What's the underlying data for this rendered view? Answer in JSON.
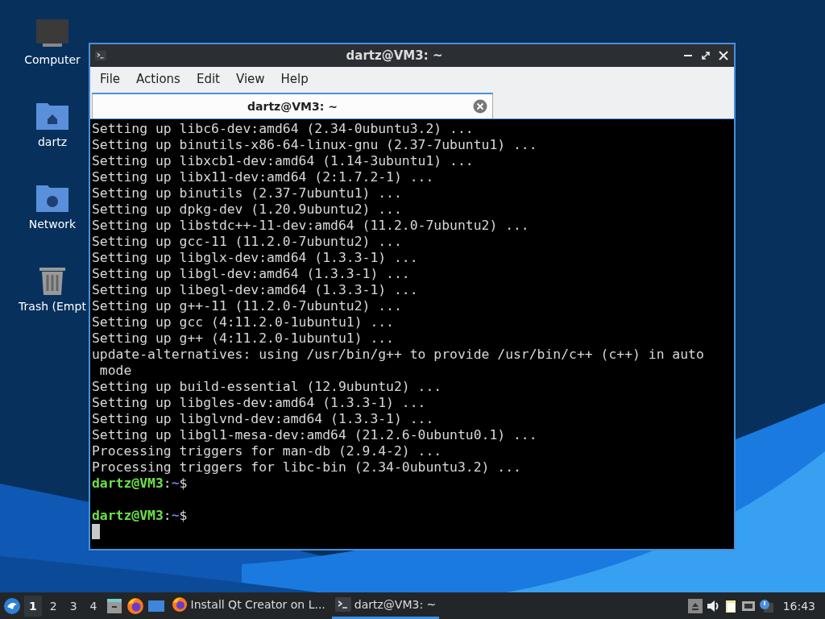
{
  "desktop_icons": [
    {
      "kind": "computer",
      "label": "Computer"
    },
    {
      "kind": "home",
      "label": "dartz"
    },
    {
      "kind": "network",
      "label": "Network"
    },
    {
      "kind": "trash",
      "label": "Trash (Empt"
    }
  ],
  "window": {
    "title": "dartz@VM3: ~",
    "menu": [
      "File",
      "Actions",
      "Edit",
      "View",
      "Help"
    ],
    "tabs": [
      {
        "label": "dartz@VM3: ~",
        "selected": true
      }
    ],
    "terminal": [
      {
        "kind": "output",
        "text": "Setting up libc6-dev:amd64 (2.34-0ubuntu3.2) ..."
      },
      {
        "kind": "output",
        "text": "Setting up binutils-x86-64-linux-gnu (2.37-7ubuntu1) ..."
      },
      {
        "kind": "output",
        "text": "Setting up libxcb1-dev:amd64 (1.14-3ubuntu1) ..."
      },
      {
        "kind": "output",
        "text": "Setting up libx11-dev:amd64 (2:1.7.2-1) ..."
      },
      {
        "kind": "output",
        "text": "Setting up binutils (2.37-7ubuntu1) ..."
      },
      {
        "kind": "output",
        "text": "Setting up dpkg-dev (1.20.9ubuntu2) ..."
      },
      {
        "kind": "output",
        "text": "Setting up libstdc++-11-dev:amd64 (11.2.0-7ubuntu2) ..."
      },
      {
        "kind": "output",
        "text": "Setting up gcc-11 (11.2.0-7ubuntu2) ..."
      },
      {
        "kind": "output",
        "text": "Setting up libglx-dev:amd64 (1.3.3-1) ..."
      },
      {
        "kind": "output",
        "text": "Setting up libgl-dev:amd64 (1.3.3-1) ..."
      },
      {
        "kind": "output",
        "text": "Setting up libegl-dev:amd64 (1.3.3-1) ..."
      },
      {
        "kind": "output",
        "text": "Setting up g++-11 (11.2.0-7ubuntu2) ..."
      },
      {
        "kind": "output",
        "text": "Setting up gcc (4:11.2.0-1ubuntu1) ..."
      },
      {
        "kind": "output",
        "text": "Setting up g++ (4:11.2.0-1ubuntu1) ..."
      },
      {
        "kind": "output",
        "text": "update-alternatives: using /usr/bin/g++ to provide /usr/bin/c++ (c++) in auto"
      },
      {
        "kind": "output",
        "text": " mode"
      },
      {
        "kind": "output",
        "text": "Setting up build-essential (12.9ubuntu2) ..."
      },
      {
        "kind": "output",
        "text": "Setting up libgles-dev:amd64 (1.3.3-1) ..."
      },
      {
        "kind": "output",
        "text": "Setting up libglvnd-dev:amd64 (1.3.3-1) ..."
      },
      {
        "kind": "output",
        "text": "Setting up libgl1-mesa-dev:amd64 (21.2.6-0ubuntu0.1) ..."
      },
      {
        "kind": "output",
        "text": "Processing triggers for man-db (2.9.4-2) ..."
      },
      {
        "kind": "output",
        "text": "Processing triggers for libc-bin (2.34-0ubuntu3.2) ..."
      },
      {
        "kind": "prompt",
        "user": "dartz@VM3",
        "sep": ":",
        "path": "~",
        "symbol": "$"
      },
      {
        "kind": "blank"
      },
      {
        "kind": "prompt",
        "user": "dartz@VM3",
        "sep": ":",
        "path": "~",
        "symbol": "$"
      },
      {
        "kind": "cursor"
      }
    ]
  },
  "taskbar": {
    "workspaces": [
      {
        "label": "1",
        "selected": true
      },
      {
        "label": "2",
        "selected": false
      },
      {
        "label": "3",
        "selected": false
      },
      {
        "label": "4",
        "selected": false
      }
    ],
    "tasks": [
      {
        "kind": "browser",
        "label": "Install Qt Creator on L...",
        "selected": false
      },
      {
        "kind": "terminal",
        "label": "dartz@VM3: ~",
        "selected": true
      }
    ],
    "clock": "16:43"
  }
}
